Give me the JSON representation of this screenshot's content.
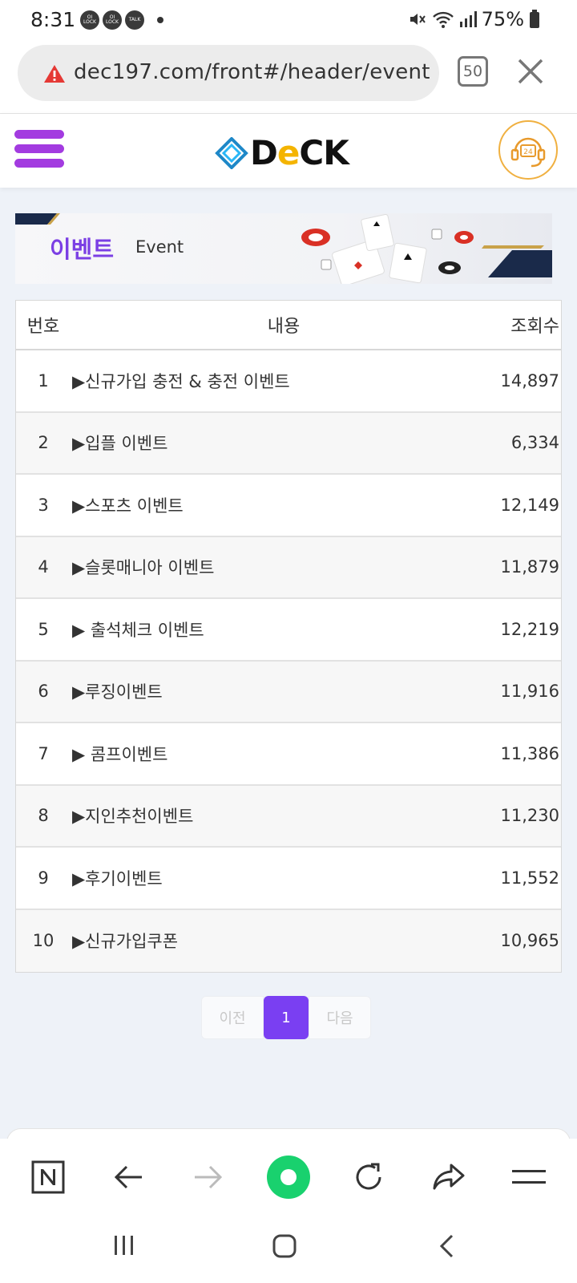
{
  "status_bar": {
    "time": "8:31",
    "notifications": [
      {
        "icon": "olock-icon",
        "label": "OI LOCK"
      },
      {
        "icon": "olock-icon",
        "label": "OI LOCK"
      },
      {
        "icon": "talk-icon",
        "label": "TALK"
      }
    ],
    "battery": "75%"
  },
  "browser": {
    "url": "dec197.com/front#/header/event",
    "tab_count": "50"
  },
  "site": {
    "logo_text_1": "D",
    "logo_text_e": "e",
    "logo_text_2": "CK",
    "support_label": "24"
  },
  "banner": {
    "title": "이벤트",
    "subtitle": "Event"
  },
  "table": {
    "headers": {
      "number": "번호",
      "content": "내용",
      "views": "조회수"
    },
    "rows": [
      {
        "number": "1",
        "title": "▶신규가입 충전 & 충전 이벤트",
        "views": "14,897"
      },
      {
        "number": "2",
        "title": "▶입플 이벤트",
        "views": "6,334"
      },
      {
        "number": "3",
        "title": "▶스포츠 이벤트",
        "views": "12,149"
      },
      {
        "number": "4",
        "title": "▶슬롯매니아 이벤트",
        "views": "11,879"
      },
      {
        "number": "5",
        "title": "▶ 출석체크 이벤트",
        "views": "12,219"
      },
      {
        "number": "6",
        "title": "▶루징이벤트",
        "views": "11,916"
      },
      {
        "number": "7",
        "title": "▶ 콤프이벤트",
        "views": "11,386"
      },
      {
        "number": "8",
        "title": "▶지인추천이벤트",
        "views": "11,230"
      },
      {
        "number": "9",
        "title": "▶후기이벤트",
        "views": "11,552"
      },
      {
        "number": "10",
        "title": "▶신규가입쿠폰",
        "views": "10,965"
      }
    ]
  },
  "pagination": {
    "prev": "이전",
    "current": "1",
    "next": "다음"
  },
  "colors": {
    "accent": "#7a3ff2",
    "menu": "#a33be0",
    "logo_e": "#f4b400",
    "warning": "#e53935"
  }
}
